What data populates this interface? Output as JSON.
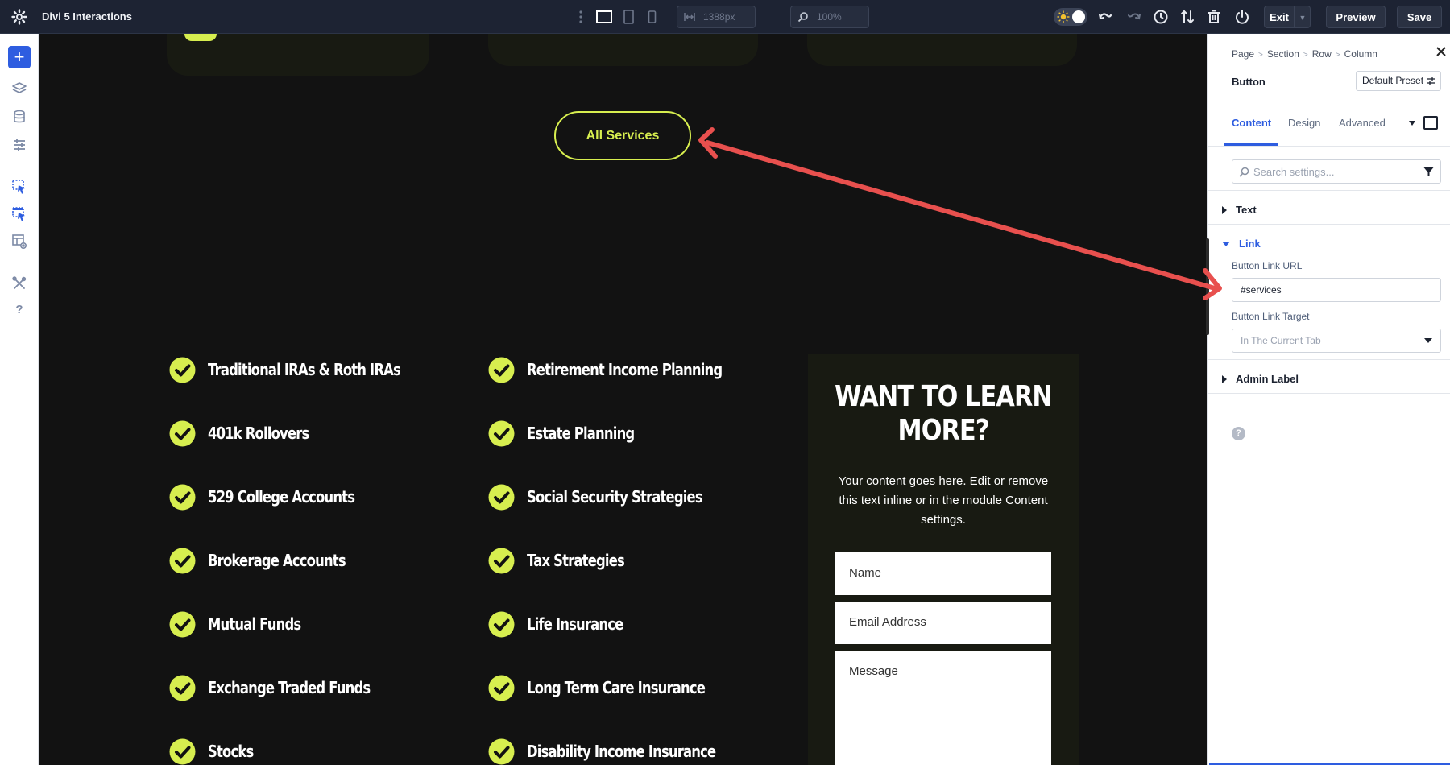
{
  "app": {
    "title": "Divi 5 Interactions"
  },
  "toolbar": {
    "width_value": "1388px",
    "zoom_value": "100%",
    "exit_label": "Exit",
    "preview_label": "Preview",
    "save_label": "Save"
  },
  "canvas": {
    "button_label": "All Services",
    "services_left": [
      "Traditional IRAs & Roth IRAs",
      "401k Rollovers",
      "529 College Accounts",
      "Brokerage Accounts",
      "Mutual Funds",
      "Exchange Traded Funds",
      "Stocks"
    ],
    "services_right": [
      "Retirement Income Planning",
      "Estate Planning",
      "Social Security Strategies",
      "Tax Strategies",
      "Life Insurance",
      "Long Term Care Insurance",
      "Disability Income Insurance"
    ],
    "cta": {
      "heading": "WANT TO LEARN MORE?",
      "body": "Your content goes here. Edit or remove this text inline or in the module Content settings.",
      "name_placeholder": "Name",
      "email_placeholder": "Email Address",
      "message_placeholder": "Message"
    },
    "accent_color": "#d7ee4f"
  },
  "panel": {
    "breadcrumbs": [
      "Page",
      "Section",
      "Row",
      "Column"
    ],
    "module": "Button",
    "preset": "Default Preset",
    "tabs": [
      "Content",
      "Design",
      "Advanced"
    ],
    "active_tab": "Content",
    "search_placeholder": "Search settings...",
    "groups": {
      "text": "Text",
      "link": "Link",
      "admin": "Admin Label"
    },
    "link": {
      "url_label": "Button Link URL",
      "url_value": "#services",
      "target_label": "Button Link Target",
      "target_value": "In The Current Tab"
    },
    "help_glyph": "?",
    "accent": "#2e5de0"
  },
  "icons": [
    "gear-icon",
    "more-dots-icon",
    "desktop-view-icon",
    "tablet-view-icon",
    "phone-view-icon",
    "width-icon",
    "zoom-icon",
    "sun-icon",
    "undo-icon",
    "redo-icon",
    "history-icon",
    "sort-icon",
    "trash-icon",
    "power-icon",
    "add-icon",
    "layers-icon",
    "database-icon",
    "sliders-icon",
    "interaction-icon",
    "interaction-alt-icon",
    "layout-preview-icon",
    "tools-icon",
    "help-icon",
    "close-icon",
    "filter-icon",
    "check-icon",
    "arrow-annotation"
  ]
}
